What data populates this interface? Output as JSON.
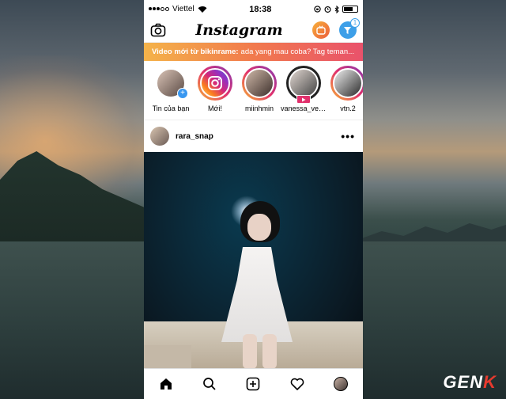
{
  "status": {
    "carrier": "Viettel",
    "time": "18:38"
  },
  "header": {
    "app_title": "Instagram"
  },
  "banner": {
    "bold": "Video mới từ bikinrame:",
    "text": "ada yang mau coba? Tag teman..."
  },
  "stories": [
    {
      "label": "Tin của bạn"
    },
    {
      "label": "Mới!"
    },
    {
      "label": "miinhmin"
    },
    {
      "label": "vanessa_ver..."
    },
    {
      "label": "vtn.2"
    }
  ],
  "post": {
    "username": "rara_snap",
    "menu_glyph": "•••"
  },
  "brand": {
    "watermark_left": "GEN",
    "watermark_right": "K"
  }
}
